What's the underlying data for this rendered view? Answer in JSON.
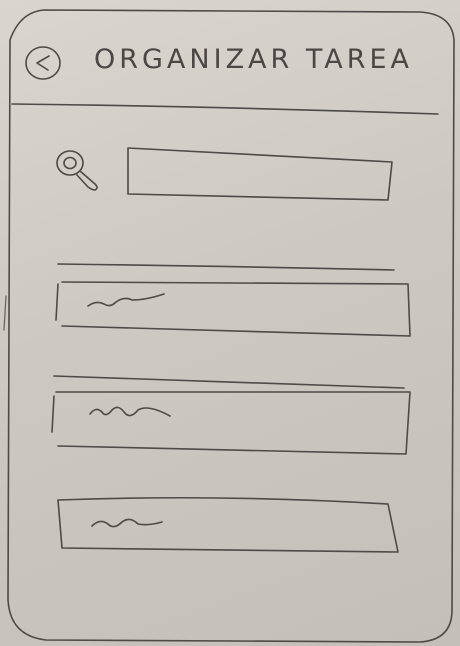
{
  "header": {
    "title": "ORGANIZAR TAREA",
    "back_icon": "back-arrow-circle-icon"
  },
  "search": {
    "icon": "search-icon",
    "value": ""
  },
  "task_list": {
    "items": [
      {
        "label": "",
        "icon": "placeholder-scribble"
      },
      {
        "label": "",
        "icon": "placeholder-scribble"
      },
      {
        "label": "",
        "icon": "placeholder-scribble"
      }
    ]
  },
  "colors": {
    "ink": "#4d4a47",
    "paper": "#d9d5cf"
  }
}
